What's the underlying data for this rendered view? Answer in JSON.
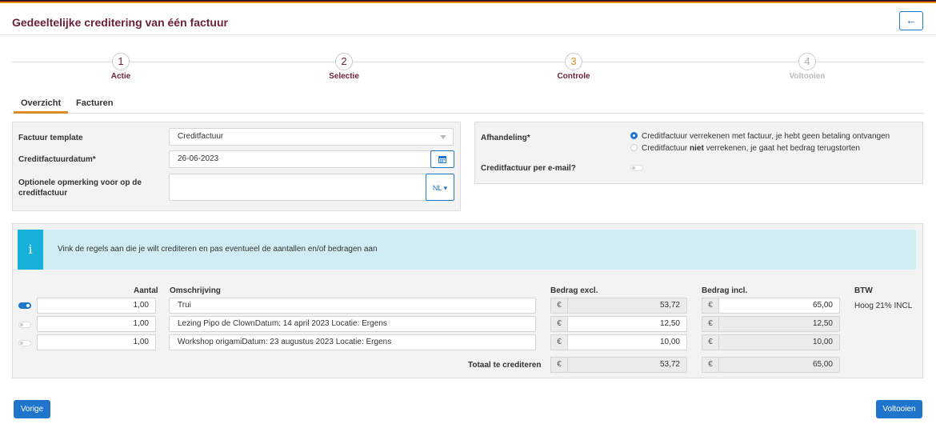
{
  "header": {
    "title": "Gedeeltelijke creditering van één factuur",
    "back_icon": "arrow-left-icon"
  },
  "wizard": {
    "steps": [
      {
        "number": "1",
        "label": "Actie"
      },
      {
        "number": "2",
        "label": "Selectie"
      },
      {
        "number": "3",
        "label": "Controle"
      },
      {
        "number": "4",
        "label": "Voltooien"
      }
    ]
  },
  "tabs": [
    {
      "label": "Overzicht"
    },
    {
      "label": "Facturen"
    }
  ],
  "form": {
    "template_label": "Factuur template",
    "template_value": "Creditfactuur",
    "date_label": "Creditfactuurdatum*",
    "date_value": "26-06-2023",
    "note_label": "Optionele opmerking voor op de creditfactuur",
    "lang_value": "NL"
  },
  "handling": {
    "label": "Afhandeling*",
    "option1": "Creditfactuur verrekenen met factuur, je hebt geen betaling ontvangen",
    "option2_pre": "Creditfactuur ",
    "option2_bold": "niet",
    "option2_post": " verrekenen, je gaat het bedrag terugstorten",
    "email_label": "Creditfactuur per e-mail?"
  },
  "info": {
    "icon": "i",
    "text": "Vink de regels aan die je wilt crediteren en pas eventueel de aantallen en/of bedragen aan"
  },
  "table": {
    "headers": {
      "qty": "Aantal",
      "desc": "Omschrijving",
      "excl": "Bedrag excl.",
      "incl": "Bedrag incl.",
      "vat": "BTW"
    },
    "currency": "€",
    "rows": [
      {
        "qty": "1,00",
        "desc": "Trui",
        "excl": "53,72",
        "incl": "65,00",
        "vat": "Hoog 21% INCL",
        "checked": true
      },
      {
        "qty": "1,00",
        "desc": "Lezing Pipo de ClownDatum: 14 april 2023  Locatie: Ergens",
        "excl": "12,50",
        "incl": "12,50",
        "vat": "",
        "checked": false
      },
      {
        "qty": "1,00",
        "desc": "Workshop origamiDatum: 23 augustus 2023  Locatie: Ergens",
        "excl": "10,00",
        "incl": "10,00",
        "vat": "",
        "checked": false
      }
    ],
    "total_label": "Totaal te crediteren",
    "total_excl": "53,72",
    "total_incl": "65,00"
  },
  "footer": {
    "prev_label": "Vorige",
    "finish_label": "Voltooien"
  },
  "colors": {
    "primary": "#1f75cb",
    "accent": "#e08c2a",
    "title": "#6b1f3a",
    "info_bg": "#d0edf5",
    "info_icon": "#17b0d9"
  }
}
